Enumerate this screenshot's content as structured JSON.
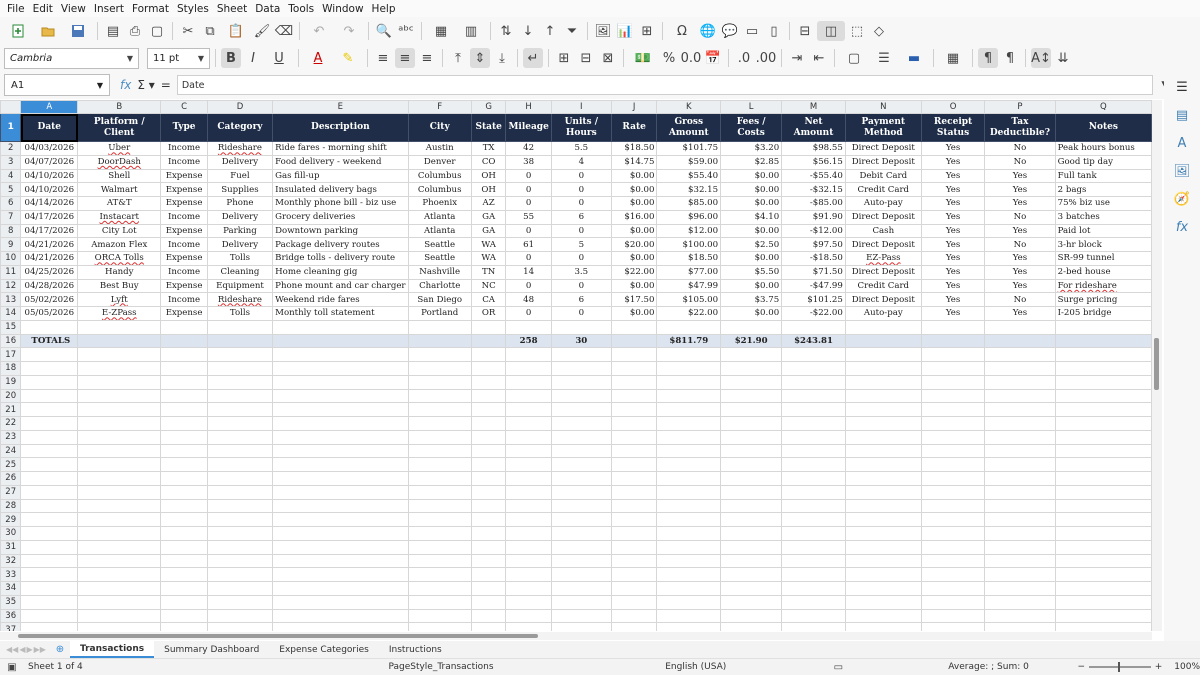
{
  "menu": [
    "File",
    "Edit",
    "View",
    "Insert",
    "Format",
    "Styles",
    "Sheet",
    "Data",
    "Tools",
    "Window",
    "Help"
  ],
  "toolbar": {
    "font_name": "Cambria",
    "font_size": "11 pt"
  },
  "formula_bar": {
    "cell_ref": "A1",
    "content": "Date"
  },
  "columns": [
    "A",
    "B",
    "C",
    "D",
    "E",
    "F",
    "G",
    "H",
    "I",
    "J",
    "K",
    "L",
    "M",
    "N",
    "O",
    "P",
    "Q"
  ],
  "headers": [
    "Date",
    "Platform / Client",
    "Type",
    "Category",
    "Description",
    "City",
    "State",
    "Mileage",
    "Units / Hours",
    "Rate",
    "Gross Amount",
    "Fees / Costs",
    "Net Amount",
    "Payment Method",
    "Receipt Status",
    "Tax Deductible?",
    "Notes"
  ],
  "rows": [
    [
      "04/03/2026",
      "Uber",
      "Income",
      "Rideshare",
      "Ride fares - morning shift",
      "Austin",
      "TX",
      "42",
      "5.5",
      "$18.50",
      "$101.75",
      "$3.20",
      "$98.55",
      "Direct Deposit",
      "Yes",
      "No",
      "Peak hours bonus"
    ],
    [
      "04/07/2026",
      "DoorDash",
      "Income",
      "Delivery",
      "Food delivery - weekend",
      "Denver",
      "CO",
      "38",
      "4",
      "$14.75",
      "$59.00",
      "$2.85",
      "$56.15",
      "Direct Deposit",
      "Yes",
      "No",
      "Good tip day"
    ],
    [
      "04/10/2026",
      "Shell",
      "Expense",
      "Fuel",
      "Gas fill-up",
      "Columbus",
      "OH",
      "0",
      "0",
      "$0.00",
      "$55.40",
      "$0.00",
      "-$55.40",
      "Debit Card",
      "Yes",
      "Yes",
      "Full tank"
    ],
    [
      "04/10/2026",
      "Walmart",
      "Expense",
      "Supplies",
      "Insulated delivery bags",
      "Columbus",
      "OH",
      "0",
      "0",
      "$0.00",
      "$32.15",
      "$0.00",
      "-$32.15",
      "Credit Card",
      "Yes",
      "Yes",
      "2 bags"
    ],
    [
      "04/14/2026",
      "AT&T",
      "Expense",
      "Phone",
      "Monthly phone bill - biz use",
      "Phoenix",
      "AZ",
      "0",
      "0",
      "$0.00",
      "$85.00",
      "$0.00",
      "-$85.00",
      "Auto-pay",
      "Yes",
      "Yes",
      "75% biz use"
    ],
    [
      "04/17/2026",
      "Instacart",
      "Income",
      "Delivery",
      "Grocery deliveries",
      "Atlanta",
      "GA",
      "55",
      "6",
      "$16.00",
      "$96.00",
      "$4.10",
      "$91.90",
      "Direct Deposit",
      "Yes",
      "No",
      "3 batches"
    ],
    [
      "04/17/2026",
      "City Lot",
      "Expense",
      "Parking",
      "Downtown parking",
      "Atlanta",
      "GA",
      "0",
      "0",
      "$0.00",
      "$12.00",
      "$0.00",
      "-$12.00",
      "Cash",
      "Yes",
      "Yes",
      "Paid lot"
    ],
    [
      "04/21/2026",
      "Amazon Flex",
      "Income",
      "Delivery",
      "Package delivery routes",
      "Seattle",
      "WA",
      "61",
      "5",
      "$20.00",
      "$100.00",
      "$2.50",
      "$97.50",
      "Direct Deposit",
      "Yes",
      "No",
      "3-hr block"
    ],
    [
      "04/21/2026",
      "ORCA Tolls",
      "Expense",
      "Tolls",
      "Bridge tolls - delivery route",
      "Seattle",
      "WA",
      "0",
      "0",
      "$0.00",
      "$18.50",
      "$0.00",
      "-$18.50",
      "EZ-Pass",
      "Yes",
      "Yes",
      "SR-99 tunnel"
    ],
    [
      "04/25/2026",
      "Handy",
      "Income",
      "Cleaning",
      "Home cleaning gig",
      "Nashville",
      "TN",
      "14",
      "3.5",
      "$22.00",
      "$77.00",
      "$5.50",
      "$71.50",
      "Direct Deposit",
      "Yes",
      "Yes",
      "2-bed house"
    ],
    [
      "04/28/2026",
      "Best Buy",
      "Expense",
      "Equipment",
      "Phone mount and car charger",
      "Charlotte",
      "NC",
      "0",
      "0",
      "$0.00",
      "$47.99",
      "$0.00",
      "-$47.99",
      "Credit Card",
      "Yes",
      "Yes",
      "For rideshare"
    ],
    [
      "05/02/2026",
      "Lyft",
      "Income",
      "Rideshare",
      "Weekend ride fares",
      "San Diego",
      "CA",
      "48",
      "6",
      "$17.50",
      "$105.00",
      "$3.75",
      "$101.25",
      "Direct Deposit",
      "Yes",
      "No",
      "Surge pricing"
    ],
    [
      "05/05/2026",
      "E-ZPass",
      "Expense",
      "Tolls",
      "Monthly toll statement",
      "Portland",
      "OR",
      "0",
      "0",
      "$0.00",
      "$22.00",
      "$0.00",
      "-$22.00",
      "Auto-pay",
      "Yes",
      "Yes",
      "I-205 bridge"
    ]
  ],
  "totals": {
    "label": "TOTALS",
    "mileage": "258",
    "units": "30",
    "gross": "$811.79",
    "fees": "$21.90",
    "net": "$243.81"
  },
  "tabs": [
    "Transactions",
    "Summary Dashboard",
    "Expense Categories",
    "Instructions"
  ],
  "status": {
    "sheet": "Sheet 1 of 4",
    "page_style": "PageStyle_Transactions",
    "language": "English (USA)",
    "summary": "Average: ; Sum: 0",
    "zoom": "100%"
  }
}
